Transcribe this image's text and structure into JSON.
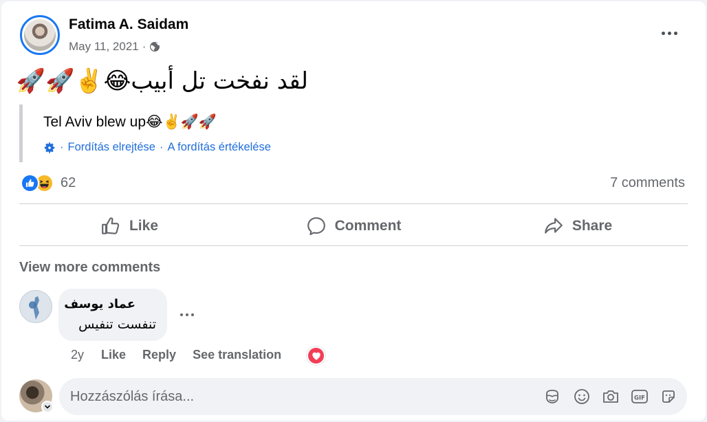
{
  "post": {
    "author": "Fatima A. Saidam",
    "date": "May 11, 2021",
    "date_separator": "·",
    "privacy_icon": "globe-icon",
    "text": "لقد نفخت تل أبيب😂✌️🚀🚀",
    "translation": {
      "text": "Tel Aviv blew up😂✌️🚀🚀",
      "separator": "·",
      "hide_label": "Fordítás elrejtése",
      "rate_label": "A fordítás értékelése"
    }
  },
  "reactions": {
    "types": [
      "like",
      "haha"
    ],
    "count": "62",
    "comments_count": "7 comments"
  },
  "actions": {
    "like": "Like",
    "comment": "Comment",
    "share": "Share"
  },
  "comments_section": {
    "view_more": "View more comments",
    "comments": [
      {
        "author": "عماد يوسف",
        "text": "تنفست تنفيس",
        "age": "2y",
        "like_label": "Like",
        "reply_label": "Reply",
        "see_translation_label": "See translation",
        "reaction": "love"
      }
    ]
  },
  "composer": {
    "placeholder": "Hozzászólás írása...",
    "icons": [
      "avatar-sticker-icon",
      "emoji-icon",
      "camera-icon",
      "gif-icon",
      "sticker-icon"
    ]
  },
  "colors": {
    "accent": "#1877f2",
    "link": "#216fdb",
    "secondary_text": "#65676b",
    "love": "#f33e58",
    "haha": "#f7b928"
  }
}
